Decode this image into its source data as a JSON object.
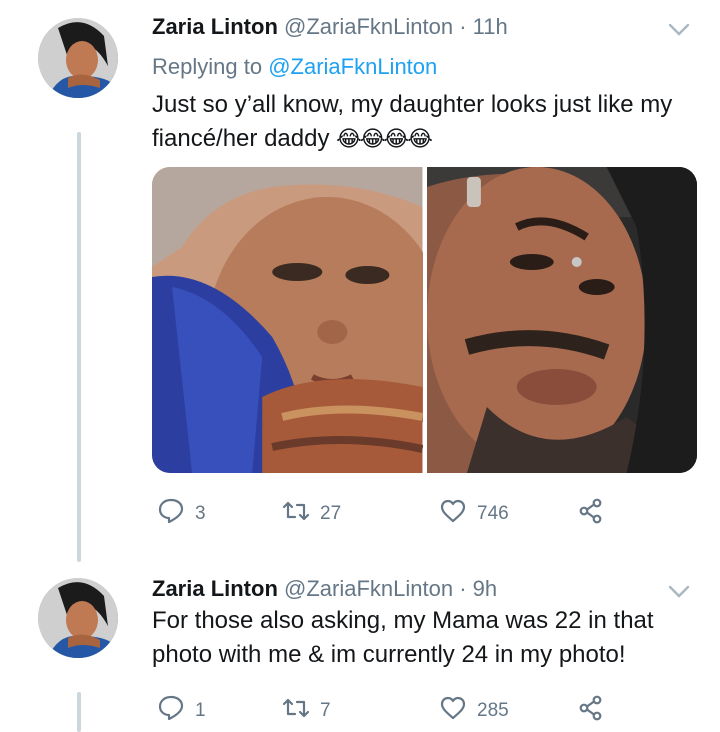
{
  "tweets": [
    {
      "name": "Zaria Linton",
      "handle": "@ZariaFknLinton",
      "separator": "·",
      "time": "11h",
      "replying_prefix": "Replying to ",
      "replying_to": "@ZariaFknLinton",
      "text_line1": "Just so y’all know, my daughter looks just like my",
      "text_line2": "fiancé/her daddy ",
      "emoji": "😂😂😂😂",
      "replies": "3",
      "retweets": "27",
      "likes": "746"
    },
    {
      "name": "Zaria Linton",
      "handle": "@ZariaFknLinton",
      "separator": "·",
      "time": "9h",
      "text_line1": "For those also asking, my Mama was 22 in that",
      "text_line2": "photo with me & im currently 24 in my photo!",
      "replies": "1",
      "retweets": "7",
      "likes": "285"
    }
  ],
  "colors": {
    "accent": "#1da1f2",
    "muted": "#657786",
    "thread": "#ccd6dd"
  },
  "icons": [
    "chevron-down-icon",
    "reply-icon",
    "retweet-icon",
    "like-icon",
    "share-icon"
  ]
}
